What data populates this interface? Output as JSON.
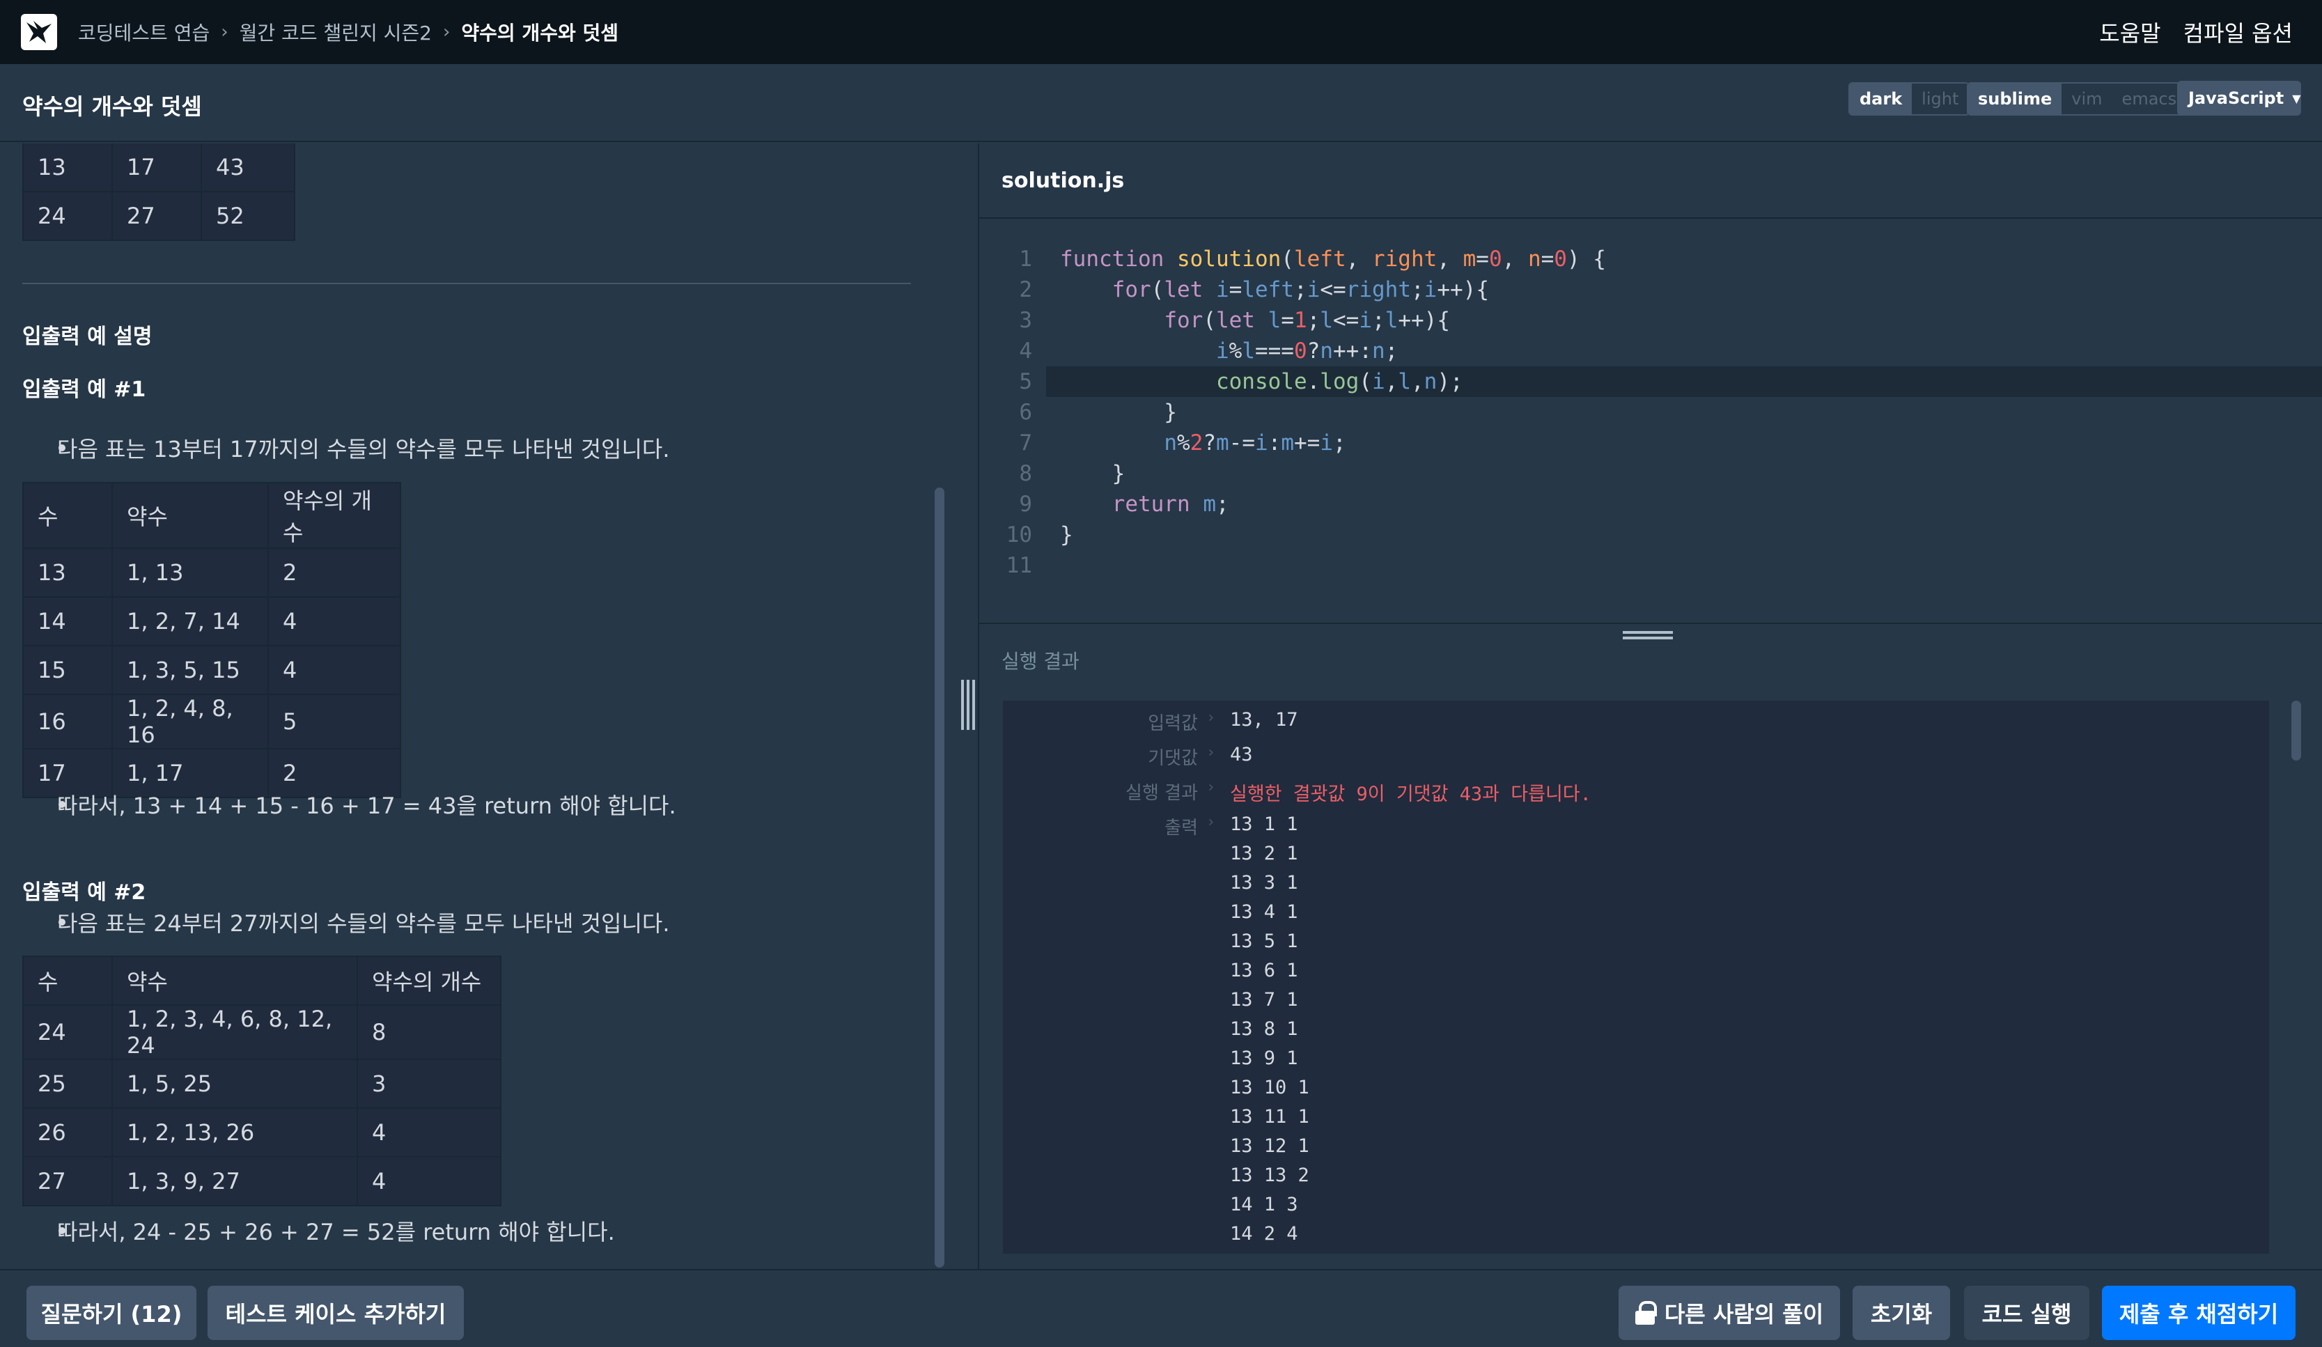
{
  "nav": {
    "breadcrumb": [
      "코딩테스트 연습",
      "월간 코드 챌린지 시즌2",
      "약수의 개수와 덧셈"
    ],
    "help": "도움말",
    "compile_options": "컴파일 옵션"
  },
  "title": "약수의 개수와 덧셈",
  "toolbar": {
    "theme": [
      "dark",
      "light"
    ],
    "keymap": [
      "sublime",
      "vim",
      "emacs"
    ],
    "language": "JavaScript"
  },
  "problem": {
    "top_table": [
      [
        "13",
        "17",
        "43"
      ],
      [
        "24",
        "27",
        "52"
      ]
    ],
    "section_title": "입출력 예 설명",
    "ex1": {
      "title": "입출력 예 #1",
      "intro": "다음 표는 13부터 17까지의 수들의 약수를 모두 나타낸 것입니다.",
      "headers": [
        "수",
        "약수",
        "약수의 개수"
      ],
      "rows": [
        [
          "13",
          "1, 13",
          "2"
        ],
        [
          "14",
          "1, 2, 7, 14",
          "4"
        ],
        [
          "15",
          "1, 3, 5, 15",
          "4"
        ],
        [
          "16",
          "1, 2, 4, 8, 16",
          "5"
        ],
        [
          "17",
          "1, 17",
          "2"
        ]
      ],
      "conclusion": "따라서, 13 + 14 + 15 - 16 + 17 = 43을 return 해야 합니다."
    },
    "ex2": {
      "title": "입출력 예 #2",
      "intro": "다음 표는 24부터 27까지의 수들의 약수를 모두 나타낸 것입니다.",
      "headers": [
        "수",
        "약수",
        "약수의 개수"
      ],
      "rows": [
        [
          "24",
          "1, 2, 3, 4, 6, 8, 12, 24",
          "8"
        ],
        [
          "25",
          "1, 5, 25",
          "3"
        ],
        [
          "26",
          "1, 2, 13, 26",
          "4"
        ],
        [
          "27",
          "1, 3, 9, 27",
          "4"
        ]
      ],
      "conclusion": "따라서, 24 - 25 + 26 + 27 = 52를 return 해야 합니다."
    }
  },
  "editor": {
    "filename": "solution.js",
    "line_numbers": [
      "1",
      "2",
      "3",
      "4",
      "5",
      "6",
      "7",
      "8",
      "9",
      "10",
      "11"
    ]
  },
  "result": {
    "title": "실행 결과",
    "labels": {
      "input": "입력값",
      "expected": "기댓값",
      "result": "실행 결과",
      "output": "출력"
    },
    "input": "13, 17",
    "expected": "43",
    "message": "실행한 결괏값 9이 기댓값 43과 다릅니다.",
    "output": [
      "13 1 1",
      "13 2 1",
      "13 3 1",
      "13 4 1",
      "13 5 1",
      "13 6 1",
      "13 7 1",
      "13 8 1",
      "13 9 1",
      "13 10 1",
      "13 11 1",
      "13 12 1",
      "13 13 2",
      "14 1 3",
      "14 2 4"
    ]
  },
  "buttons": {
    "question": "질문하기 (12)",
    "add_testcase": "테스트 케이스 추가하기",
    "others_solution": "다른 사람의 풀이",
    "reset": "초기화",
    "run": "코드 실행",
    "submit": "제출 후 채점하기"
  }
}
